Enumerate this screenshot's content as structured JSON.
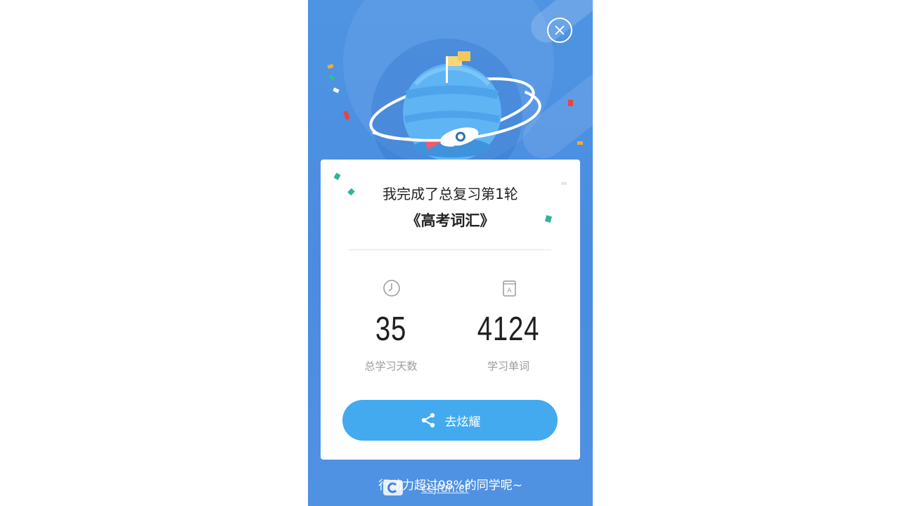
{
  "card": {
    "headline": "我完成了总复习第1轮",
    "book_title": "《高考词汇》"
  },
  "stats": {
    "days": {
      "value": "35",
      "label": "总学习天数",
      "icon": "clock-icon"
    },
    "words": {
      "value": "4124",
      "label": "学习单词",
      "icon": "book-icon"
    }
  },
  "share_button": {
    "label": "去炫耀",
    "icon": "share-icon"
  },
  "footer": {
    "text": "行动力超过98%的同学呢~"
  },
  "watermark": {
    "text": "ccjfun.cf"
  },
  "colors": {
    "background": "#4a8ce0",
    "button": "#43aaf0",
    "card": "#ffffff"
  }
}
